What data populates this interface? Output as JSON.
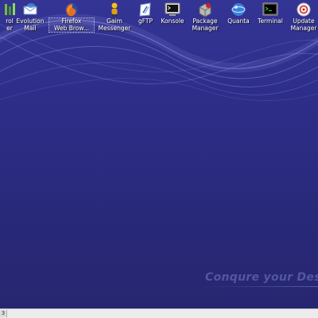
{
  "desktop": {
    "icons": [
      {
        "label": "rol\ner",
        "icon": "control-center-icon"
      },
      {
        "label": "Evolution\nMail",
        "icon": "evolution-mail-icon"
      },
      {
        "label": "Firefox\nWeb Brow...",
        "icon": "firefox-icon"
      },
      {
        "label": "Gaim\nMessenger",
        "icon": "gaim-icon"
      },
      {
        "label": "gFTP",
        "icon": "gftp-icon"
      },
      {
        "label": "Konsole",
        "icon": "konsole-icon"
      },
      {
        "label": "Package\nManager",
        "icon": "package-manager-icon"
      },
      {
        "label": "Quanta",
        "icon": "quanta-icon"
      },
      {
        "label": "Terminal",
        "icon": "terminal-icon"
      },
      {
        "label": "Update\nManager",
        "icon": "update-manager-icon"
      }
    ],
    "slogan": "Conqure your Des"
  },
  "taskbar": {
    "tab_label": "3"
  }
}
